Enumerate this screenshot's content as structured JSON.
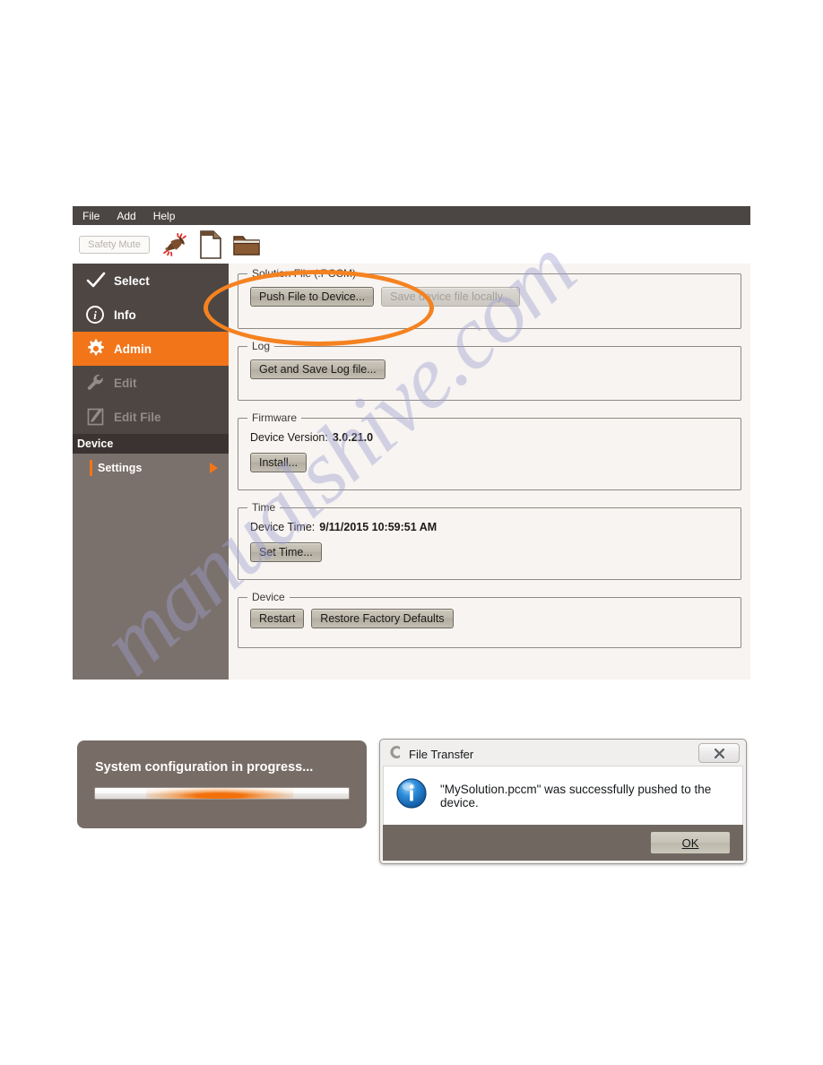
{
  "watermark": {
    "text": "manualshive.com"
  },
  "app": {
    "menu": [
      {
        "label": "File"
      },
      {
        "label": "Add"
      },
      {
        "label": "Help"
      }
    ],
    "toolbar": {
      "safety_mute_label": "Safety Mute",
      "icons": [
        {
          "name": "mute-speaker-icon"
        },
        {
          "name": "new-file-icon"
        },
        {
          "name": "open-folder-icon"
        }
      ]
    },
    "sidebar": {
      "items": [
        {
          "label": "Select",
          "icon": "check-icon",
          "state": "normal"
        },
        {
          "label": "Info",
          "icon": "info-circle-icon",
          "state": "normal"
        },
        {
          "label": "Admin",
          "icon": "gear-icon",
          "state": "active"
        },
        {
          "label": "Edit",
          "icon": "wrench-icon",
          "state": "disabled"
        },
        {
          "label": "Edit File",
          "icon": "pencil-square-icon",
          "state": "disabled"
        }
      ],
      "section_header": "Device",
      "sub_items": [
        {
          "label": "Settings",
          "has_arrow": true
        }
      ]
    },
    "content": {
      "groups": [
        {
          "title": "Solution File (.PCCM)",
          "buttons": [
            {
              "label": "Push File to Device...",
              "disabled": false
            },
            {
              "label": "Save device file locally...",
              "disabled": true
            }
          ]
        },
        {
          "title": "Log",
          "buttons": [
            {
              "label": "Get and Save Log file...",
              "disabled": false
            }
          ]
        },
        {
          "title": "Firmware",
          "field_label": "Device Version:",
          "field_value": "3.0.21.0",
          "buttons": [
            {
              "label": "Install...",
              "disabled": false
            }
          ]
        },
        {
          "title": "Time",
          "field_label": "Device Time:",
          "field_value": "9/11/2015 10:59:51 AM",
          "buttons": [
            {
              "label": "Set Time...",
              "disabled": false
            }
          ]
        },
        {
          "title": "Device",
          "buttons": [
            {
              "label": "Restart",
              "disabled": false
            },
            {
              "label": "Restore Factory Defaults",
              "disabled": false
            }
          ]
        }
      ]
    },
    "annotation": {
      "name": "orange-highlight-ellipse",
      "color": "#f58220"
    }
  },
  "progress_toast": {
    "title": "System configuration in progress...",
    "progress_indeterminate": true
  },
  "file_transfer_dialog": {
    "title": "File Transfer",
    "icon": "app-c-icon",
    "close_label": "✕",
    "message": "\"MySolution.pccm\" was successfully pushed to the device.",
    "ok_label": "OK"
  },
  "colors": {
    "accent_orange": "#f2751a",
    "annotation_orange": "#f58220",
    "sidebar_bg": "#7b716c",
    "sidebar_top_bg": "#4d4643",
    "menu_bg": "#4b4644",
    "panel_bg": "#f7f4f1",
    "toast_bg": "#776c66"
  }
}
